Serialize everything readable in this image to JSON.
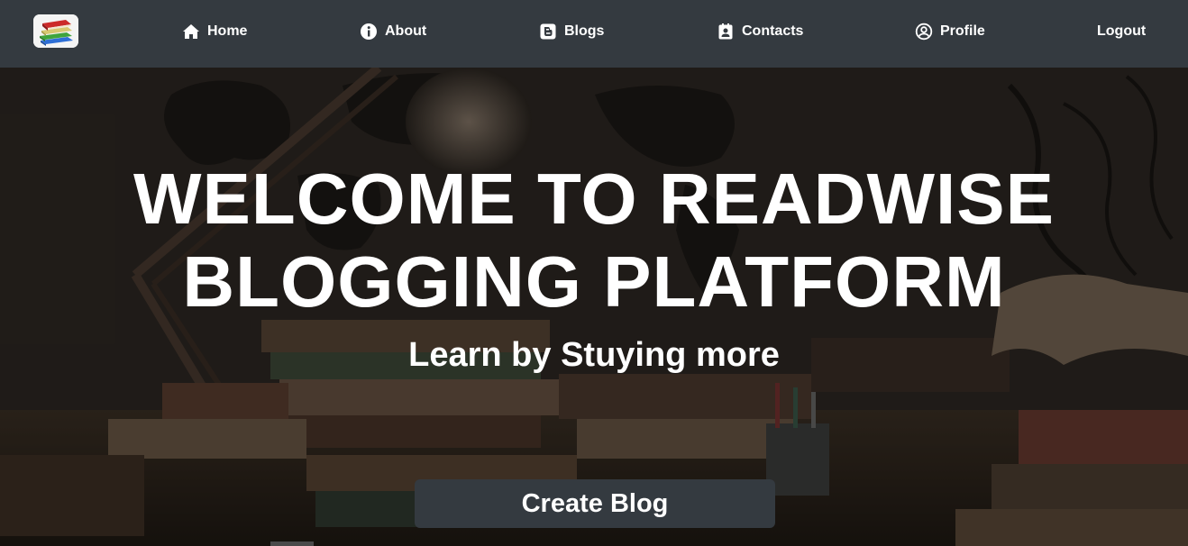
{
  "navbar": {
    "logo_icon": "books-stack-icon",
    "items": [
      {
        "label": "Home",
        "icon": "home-icon"
      },
      {
        "label": "About",
        "icon": "info-circle-icon"
      },
      {
        "label": "Blogs",
        "icon": "blog-icon"
      },
      {
        "label": "Contacts",
        "icon": "contact-card-icon"
      },
      {
        "label": "Profile",
        "icon": "user-circle-icon"
      },
      {
        "label": "Logout"
      }
    ],
    "bg_color": "#343a40"
  },
  "hero": {
    "title_line1": "WELCOME TO READWISE",
    "title_line2": "BLOGGING PLATFORM",
    "subtitle": "Learn by Stuying more",
    "cta_label": "Create Blog",
    "background": "dark-library-desk-photo"
  },
  "colors": {
    "accent": "#343a40",
    "text": "#ffffff"
  }
}
